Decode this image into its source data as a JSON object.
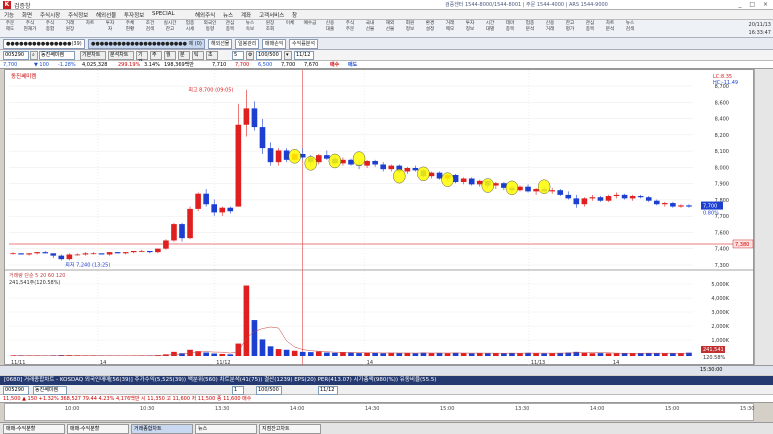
{
  "window": {
    "app_name": "검증창",
    "app_logo": "K",
    "info": "검증센터 1544-8000/1544-8001 | 주문 1544-4000 | ARS 1544-9000",
    "win_controls": "_ □ ×"
  },
  "menu": [
    "기능",
    "화면",
    "주식시장",
    "주식정보",
    "해외선물",
    "투자정보",
    "SPECIAL",
    "해외주식",
    "뉴스",
    "계좌",
    "고객서비스",
    "창"
  ],
  "toolbar": {
    "items": [
      "주문\n제도",
      "주식\n현재가",
      "주식\n종합",
      "거래\n원장",
      "차트",
      "투자\n자",
      "주체\n현황",
      "조건\n검색",
      "실시간\n잔고",
      "업종\n시세",
      "외국인\n동향",
      "관심\n종목",
      "뉴스\n속보",
      "원장\n조회",
      "이체",
      "예수금",
      "신용\n대출",
      "주식\n주문",
      "국내\n선물",
      "해외\n선물",
      "회원\n정보",
      "환경\n설정",
      "거래\n메모",
      "투자\n정보",
      "시간\n대별",
      "테마\n종목",
      "업종\n분석",
      "신용\n거래",
      "잔고\n평가",
      "관심\n종목",
      "차트\n분석",
      "뉴스\n검색"
    ],
    "date": "20/11/13",
    "time": "16:33:47"
  },
  "tabs": [
    "●●●●●●●●●●●●●●●(39)",
    "●●●●●●●●●●●●●●●●●●●●●● 제 (0)",
    "해외선물",
    "일봉관리",
    "매매손익",
    "수익률분석"
  ],
  "ctrl": {
    "code": "005290",
    "name": "동진쎄미켐",
    "period_buttons": [
      "기본차트",
      "분석차트",
      "기간",
      "주",
      "월",
      "분",
      "틱",
      "초"
    ],
    "timeframe": "5",
    "count": "100/500",
    "date": "11/12"
  },
  "quote": {
    "price": "7,700",
    "change": "▼ 100",
    "change_pct": "-1.28%",
    "volume": "4,025,328",
    "vol_pct": "299.19%",
    "rate": "3.14%",
    "amount": "198,369백만",
    "open": "7,710",
    "high": "7,700",
    "low": "6,500",
    "close": "7,700",
    "prev": "7,670",
    "buy": "매수",
    "sell": "매도"
  },
  "chart": {
    "title": "동진쎄미켐",
    "high_label": "최고 8,700 (09:05)",
    "low_label": "최저 7,240 (13:25)",
    "legend_right_1": "LC:8.35",
    "legend_right_2": "HC:-11.49",
    "price_axis": [
      "8,700",
      "8,600",
      "8,400",
      "8,200",
      "8,100",
      "8,000",
      "7,900",
      "7,800",
      "7,700",
      "7,600",
      "7,400",
      "7,300"
    ],
    "current_price_label": "7,700",
    "current_pct_label": "0.80%",
    "ref_line_label": "7,380",
    "volume_label": "거래량 단순 5 20 60 120",
    "volume_value": "241,541주(120.58%)",
    "volume_axis": [
      "5,000K",
      "4,000K",
      "3,000K",
      "2,000K",
      "1,000K"
    ],
    "vol_current_label": "241,541",
    "vol_pct_label": "120.58%",
    "time_axis": [
      "11/11",
      "14",
      "11/12",
      "14",
      "11/13",
      "14"
    ],
    "bottom_time": "15:30:00"
  },
  "panel2": {
    "header": "[0680] 거래종합차트 - KOSDAQ 외국인매매[56(39)] 주가수익(5,525(39)) 백분위(560) 차트분석(41(75)) 결산(1239) EPS(20) PER(413.07) 시가총액(980(%)) 유동비율(55.5)",
    "code": "005290",
    "name": "동진쎄미켐",
    "timeframe": "1",
    "count": "100/500",
    "date": "11/12",
    "quote": "11,500 ▲ 150 +1.32% 368,527 79.44 4.23% 4,176백만 시 11,350 고 11,600 저 11,500 종 11,600 매수",
    "times": [
      "10:00",
      "10:30",
      "13:30",
      "14:00",
      "14:30",
      "15:00",
      "13:30",
      "14:00",
      "15:00",
      "15:30"
    ]
  },
  "taskbar": [
    "매매-수익분할",
    "매매-수익분할",
    "거래종합차트",
    "뉴스",
    "지점잔고차트"
  ],
  "chart_data": {
    "type": "candlestick",
    "price_range": [
      7200,
      8800
    ],
    "volume_range": [
      0,
      5500000
    ],
    "series": [
      {
        "name": "candles",
        "values": [
          [
            7300,
            7310,
            7290,
            7300
          ],
          [
            7300,
            7300,
            7290,
            7290
          ],
          [
            7290,
            7300,
            7280,
            7300
          ],
          [
            7300,
            7310,
            7290,
            7310
          ],
          [
            7310,
            7320,
            7300,
            7300
          ],
          [
            7300,
            7300,
            7260,
            7280
          ],
          [
            7280,
            7290,
            7240,
            7250
          ],
          [
            7250,
            7300,
            7240,
            7290
          ],
          [
            7290,
            7300,
            7280,
            7290
          ],
          [
            7290,
            7310,
            7280,
            7300
          ],
          [
            7300,
            7310,
            7290,
            7300
          ],
          [
            7300,
            7300,
            7290,
            7290
          ],
          [
            7290,
            7310,
            7280,
            7310
          ],
          [
            7310,
            7310,
            7300,
            7300
          ],
          [
            7300,
            7310,
            7290,
            7310
          ],
          [
            7310,
            7320,
            7300,
            7320
          ],
          [
            7320,
            7330,
            7310,
            7320
          ],
          [
            7320,
            7320,
            7300,
            7310
          ],
          [
            7310,
            7340,
            7300,
            7340
          ],
          [
            7340,
            7420,
            7330,
            7410
          ],
          [
            7410,
            7560,
            7400,
            7550
          ],
          [
            7550,
            7560,
            7400,
            7430
          ],
          [
            7430,
            7700,
            7420,
            7680
          ],
          [
            7680,
            7820,
            7660,
            7810
          ],
          [
            7810,
            7850,
            7700,
            7720
          ],
          [
            7720,
            7760,
            7620,
            7650
          ],
          [
            7650,
            7700,
            7620,
            7690
          ],
          [
            7690,
            7700,
            7640,
            7660
          ],
          [
            7700,
            8580,
            7700,
            8400
          ],
          [
            8400,
            8700,
            8300,
            8540
          ],
          [
            8540,
            8600,
            8350,
            8380
          ],
          [
            8380,
            8450,
            8150,
            8200
          ],
          [
            8200,
            8250,
            8050,
            8080
          ],
          [
            8080,
            8200,
            8050,
            8180
          ],
          [
            8180,
            8200,
            8080,
            8100
          ],
          [
            8100,
            8160,
            8080,
            8150
          ],
          [
            8150,
            8200,
            8100,
            8120
          ],
          [
            8120,
            8140,
            8050,
            8080
          ],
          [
            8080,
            8150,
            8060,
            8140
          ],
          [
            8140,
            8180,
            8100,
            8110
          ],
          [
            8110,
            8130,
            8060,
            8070
          ],
          [
            8070,
            8120,
            8050,
            8100
          ],
          [
            8100,
            8110,
            8050,
            8060
          ],
          [
            8060,
            8080,
            8020,
            8050
          ],
          [
            8050,
            8100,
            8030,
            8090
          ],
          [
            8090,
            8100,
            8040,
            8060
          ],
          [
            8060,
            8080,
            8000,
            8020
          ],
          [
            8020,
            8060,
            8000,
            8050
          ],
          [
            8050,
            8060,
            7990,
            8000
          ],
          [
            8000,
            8040,
            7980,
            8030
          ],
          [
            8030,
            8050,
            8000,
            8010
          ],
          [
            8010,
            8020,
            7950,
            7960
          ],
          [
            7960,
            8000,
            7940,
            7990
          ],
          [
            7990,
            8000,
            7930,
            7940
          ],
          [
            7940,
            7980,
            7920,
            7970
          ],
          [
            7970,
            7980,
            7900,
            7910
          ],
          [
            7910,
            7950,
            7890,
            7940
          ],
          [
            7940,
            7950,
            7880,
            7890
          ],
          [
            7890,
            7930,
            7870,
            7920
          ],
          [
            7920,
            7930,
            7860,
            7880
          ],
          [
            7880,
            7910,
            7850,
            7900
          ],
          [
            7900,
            7910,
            7840,
            7860
          ],
          [
            7860,
            7880,
            7820,
            7840
          ],
          [
            7840,
            7880,
            7830,
            7870
          ],
          [
            7870,
            7890,
            7820,
            7830
          ],
          [
            7830,
            7860,
            7800,
            7850
          ],
          [
            7850,
            7870,
            7820,
            7830
          ],
          [
            7830,
            7860,
            7810,
            7840
          ],
          [
            7840,
            7850,
            7790,
            7800
          ],
          [
            7800,
            7830,
            7760,
            7770
          ],
          [
            7770,
            7800,
            7690,
            7720
          ],
          [
            7720,
            7780,
            7700,
            7770
          ],
          [
            7770,
            7800,
            7750,
            7780
          ],
          [
            7780,
            7790,
            7740,
            7750
          ],
          [
            7750,
            7800,
            7740,
            7790
          ],
          [
            7790,
            7820,
            7770,
            7800
          ],
          [
            7800,
            7810,
            7760,
            7770
          ],
          [
            7770,
            7800,
            7750,
            7790
          ],
          [
            7790,
            7800,
            7770,
            7780
          ],
          [
            7780,
            7790,
            7740,
            7750
          ],
          [
            7750,
            7760,
            7710,
            7720
          ],
          [
            7720,
            7740,
            7700,
            7730
          ],
          [
            7730,
            7740,
            7690,
            7700
          ],
          [
            7700,
            7720,
            7690,
            7710
          ],
          [
            7710,
            7720,
            7690,
            7700
          ]
        ]
      },
      {
        "name": "volume",
        "values": [
          40000,
          30000,
          25000,
          30000,
          20000,
          40000,
          60000,
          50000,
          30000,
          20000,
          25000,
          20000,
          30000,
          25000,
          20000,
          30000,
          35000,
          30000,
          60000,
          120000,
          300000,
          200000,
          450000,
          350000,
          250000,
          180000,
          150000,
          120000,
          900000,
          5100000,
          2600000,
          1200000,
          700000,
          500000,
          450000,
          380000,
          300000,
          280000,
          320000,
          250000,
          230000,
          260000,
          240000,
          210000,
          230000,
          220000,
          200000,
          230000,
          210000,
          220000,
          200000,
          240000,
          210000,
          220000,
          200000,
          230000,
          210000,
          190000,
          220000,
          200000,
          210000,
          190000,
          220000,
          200000,
          230000,
          210000,
          190000,
          200000,
          220000,
          250000,
          300000,
          240000,
          200000,
          210000,
          190000,
          200000,
          210000,
          190000,
          200000,
          220000,
          210000,
          190000,
          200000,
          180000,
          241541
        ]
      }
    ],
    "markers": [
      8130,
      8070,
      8090,
      8110,
      7960,
      7980,
      7930,
      7880,
      7860,
      7870
    ]
  }
}
